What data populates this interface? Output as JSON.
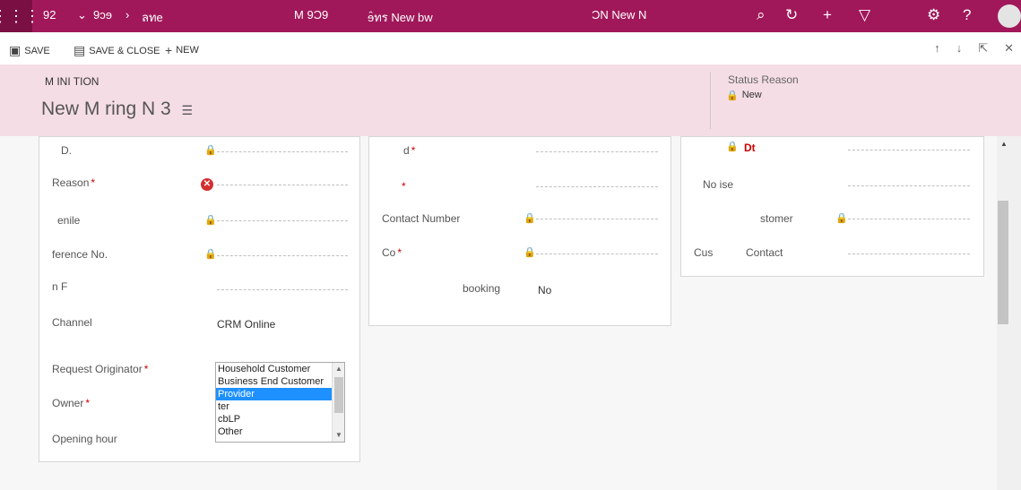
{
  "topbar": {
    "app_name": "92",
    "crumb_1": "9ɔɘ",
    "crumb_2": "ลทе",
    "tab_1": "M 9Ɔ9",
    "tab_2": "ɘ̂ทร New bw",
    "tab_3": "ƆN New N"
  },
  "commands": {
    "save": "SAVE",
    "save_close": "SAVE & CLOSE",
    "new": "NEW"
  },
  "header": {
    "entity": "M INI TION",
    "title": "New M ring N 3",
    "status_label": "Status Reason",
    "status_value": "New"
  },
  "left": {
    "field_1_label": "D.",
    "field_2_label": "Reason",
    "field_3_label": "enile",
    "field_4_label": "ference No.",
    "field_5_label": "n F",
    "channel_label": "Channel",
    "channel_value": "CRM Online",
    "originator_label": "Request Originator",
    "owner_label": "Owner",
    "opening_label": "Opening hour",
    "options": [
      "Household Customer",
      "Business End Customer",
      "Provider",
      "ter",
      "cbLP",
      "Other"
    ]
  },
  "middle": {
    "field_1_label": "d",
    "field_2_label": "",
    "contact_label": "Contact Number",
    "field_4_label": "Co",
    "booking_label": "booking",
    "booking_value": "No"
  },
  "right": {
    "field_1_value": "Dt",
    "noise_label": "No ise",
    "bus_label": "stomer",
    "cust_contact_label": "Contact",
    "cust_prefix": "Cus"
  }
}
